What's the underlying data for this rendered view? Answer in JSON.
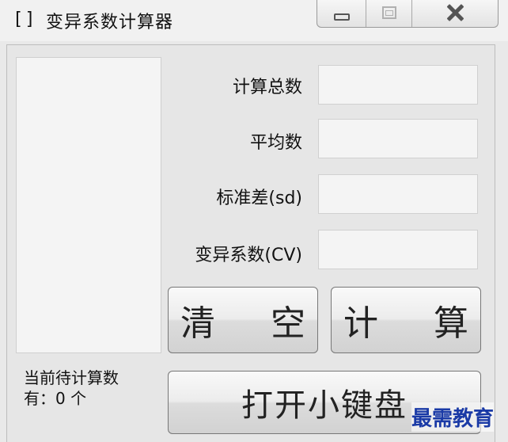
{
  "window": {
    "icon_text": "[]",
    "title": "变异系数计算器"
  },
  "fields": [
    {
      "label": "计算总数",
      "value": ""
    },
    {
      "label": "平均数",
      "value": ""
    },
    {
      "label": "标准差(sd)",
      "value": ""
    },
    {
      "label": "变异系数(CV)",
      "value": ""
    }
  ],
  "buttons": {
    "clear": "清 空",
    "calculate": "计 算",
    "open_keypad": "打开小键盘"
  },
  "status": {
    "line1": "当前待计算数",
    "line2": "有：0 个"
  },
  "watermark": "最需教育"
}
